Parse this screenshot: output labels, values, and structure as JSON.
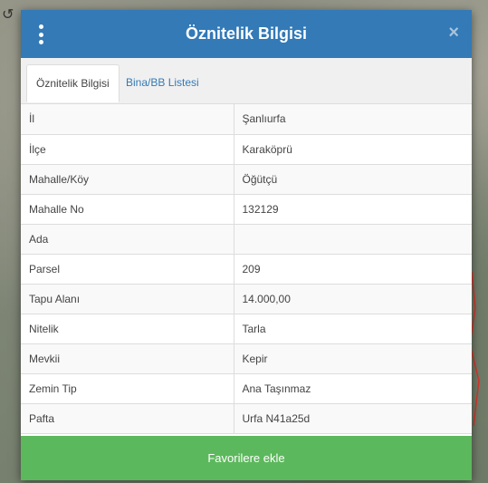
{
  "dialog": {
    "title": "Öznitelik Bilgisi",
    "close_symbol": "×"
  },
  "tabs": [
    {
      "label": "Öznitelik Bilgisi",
      "active": true
    },
    {
      "label": "Bina/BB Listesi",
      "active": false
    }
  ],
  "rows": [
    {
      "key": "İl",
      "value": "Şanlıurfa"
    },
    {
      "key": "İlçe",
      "value": "Karaköprü"
    },
    {
      "key": "Mahalle/Köy",
      "value": "Öğütçü"
    },
    {
      "key": "Mahalle No",
      "value": "132129"
    },
    {
      "key": "Ada",
      "value": ""
    },
    {
      "key": "Parsel",
      "value": "209"
    },
    {
      "key": "Tapu Alanı",
      "value": "14.000,00"
    },
    {
      "key": "Nitelik",
      "value": "Tarla"
    },
    {
      "key": "Mevkii",
      "value": "Kepir"
    },
    {
      "key": "Zemin Tip",
      "value": "Ana Taşınmaz"
    },
    {
      "key": "Pafta",
      "value": "Urfa N41a25d"
    }
  ],
  "footer": {
    "favorite_button_label": "Favorilere ekle"
  },
  "colors": {
    "header": "#337ab7",
    "button": "#5cb85c"
  }
}
